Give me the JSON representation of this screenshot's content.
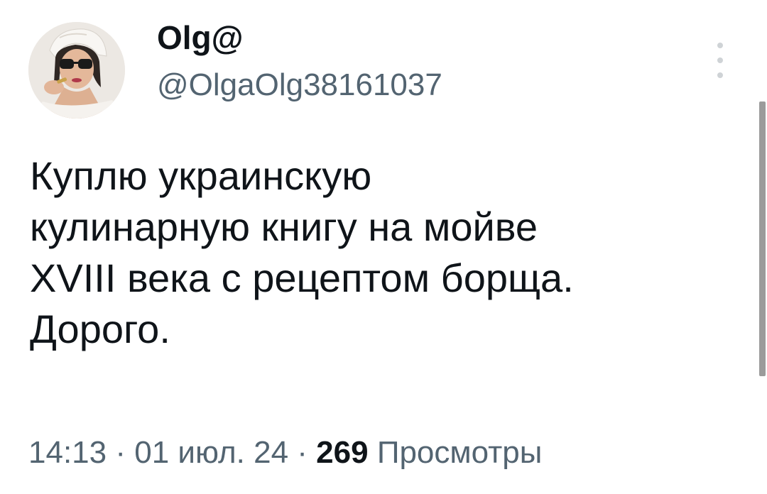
{
  "author": {
    "display_name": "Olg@",
    "handle": "@OlgaOlg38161037"
  },
  "more_icon": "more-vertical-icon",
  "tweet": {
    "lines": [
      "Куплю украинскую",
      "кулинарную книгу на мойве",
      "XVIII века с рецептом борща.",
      "Дорого."
    ]
  },
  "meta": {
    "time": "14:13",
    "separator": " · ",
    "date": "01 июл. 24",
    "views_count": "269",
    "views_label": "Просмотры"
  },
  "colors": {
    "text": "#0f1419",
    "secondary": "#536471"
  }
}
